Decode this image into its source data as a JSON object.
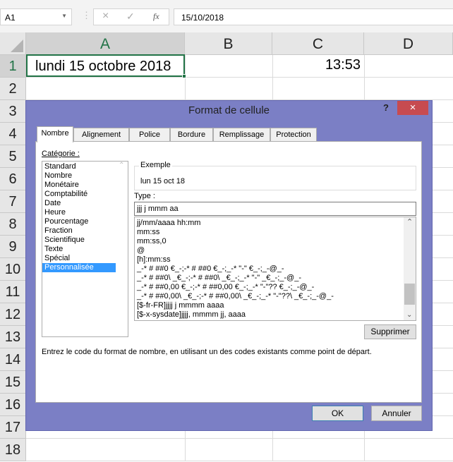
{
  "formula_bar": {
    "name_box": "A1",
    "formula": "15/10/2018",
    "cancel_icon": "×",
    "enter_icon": "✓",
    "fx_icon": "fx"
  },
  "sheet": {
    "columns": [
      "A",
      "B",
      "C",
      "D"
    ],
    "rows": [
      "1",
      "2",
      "3",
      "4",
      "5",
      "6",
      "7",
      "8",
      "9",
      "10",
      "11",
      "12",
      "13",
      "14",
      "15",
      "16",
      "17",
      "18"
    ],
    "cells": {
      "A1": "lundi 15 octobre 2018",
      "C1": "13:53"
    },
    "selection_color": "#217346"
  },
  "dialog": {
    "title": "Format de cellule",
    "help": "?",
    "close": "×",
    "tabs": [
      "Nombre",
      "Alignement",
      "Police",
      "Bordure",
      "Remplissage",
      "Protection"
    ],
    "category_label": "Catégorie :",
    "categories": [
      "Standard",
      "Nombre",
      "Monétaire",
      "Comptabilité",
      "Date",
      "Heure",
      "Pourcentage",
      "Fraction",
      "Scientifique",
      "Texte",
      "Spécial",
      "Personnalisée"
    ],
    "selected_category": "Personnalisée",
    "example_label": "Exemple",
    "example_value": "lun 15 oct 18",
    "type_label": "Type :",
    "type_value": "jjj j mmm aa",
    "formats": [
      "jj/mm/aaaa hh:mm",
      "mm:ss",
      "mm:ss,0",
      "@",
      "[h]:mm:ss",
      "_-* # ##0 €_-;-* # ##0 €_-;_-* \"-\" €_-;_-@_-",
      "_-* # ##0\\ _€_-;-* # ##0\\ _€_-;_-* \"-\" _€_-;_-@_-",
      "_-* # ##0,00 €_-;-* # ##0,00 €_-;_-* \"-\"?? €_-;_-@_-",
      "_-* # ##0,00\\ _€_-;-* # ##0,00\\ _€_-;_-* \"-\"??\\ _€_-;_-@_-",
      "[$-fr-FR]jjjj j mmmm aaaa",
      "[$-x-sysdate]jjjj, mmmm jj, aaaa"
    ],
    "delete_button": "Supprimer",
    "description": "Entrez le code du format de nombre, en utilisant un des codes existants comme point de départ.",
    "ok_button": "OK",
    "cancel_button": "Annuler",
    "title_bar_color": "#7b7fc5",
    "close_color": "#c74b50",
    "selection_color": "#3399ff"
  }
}
